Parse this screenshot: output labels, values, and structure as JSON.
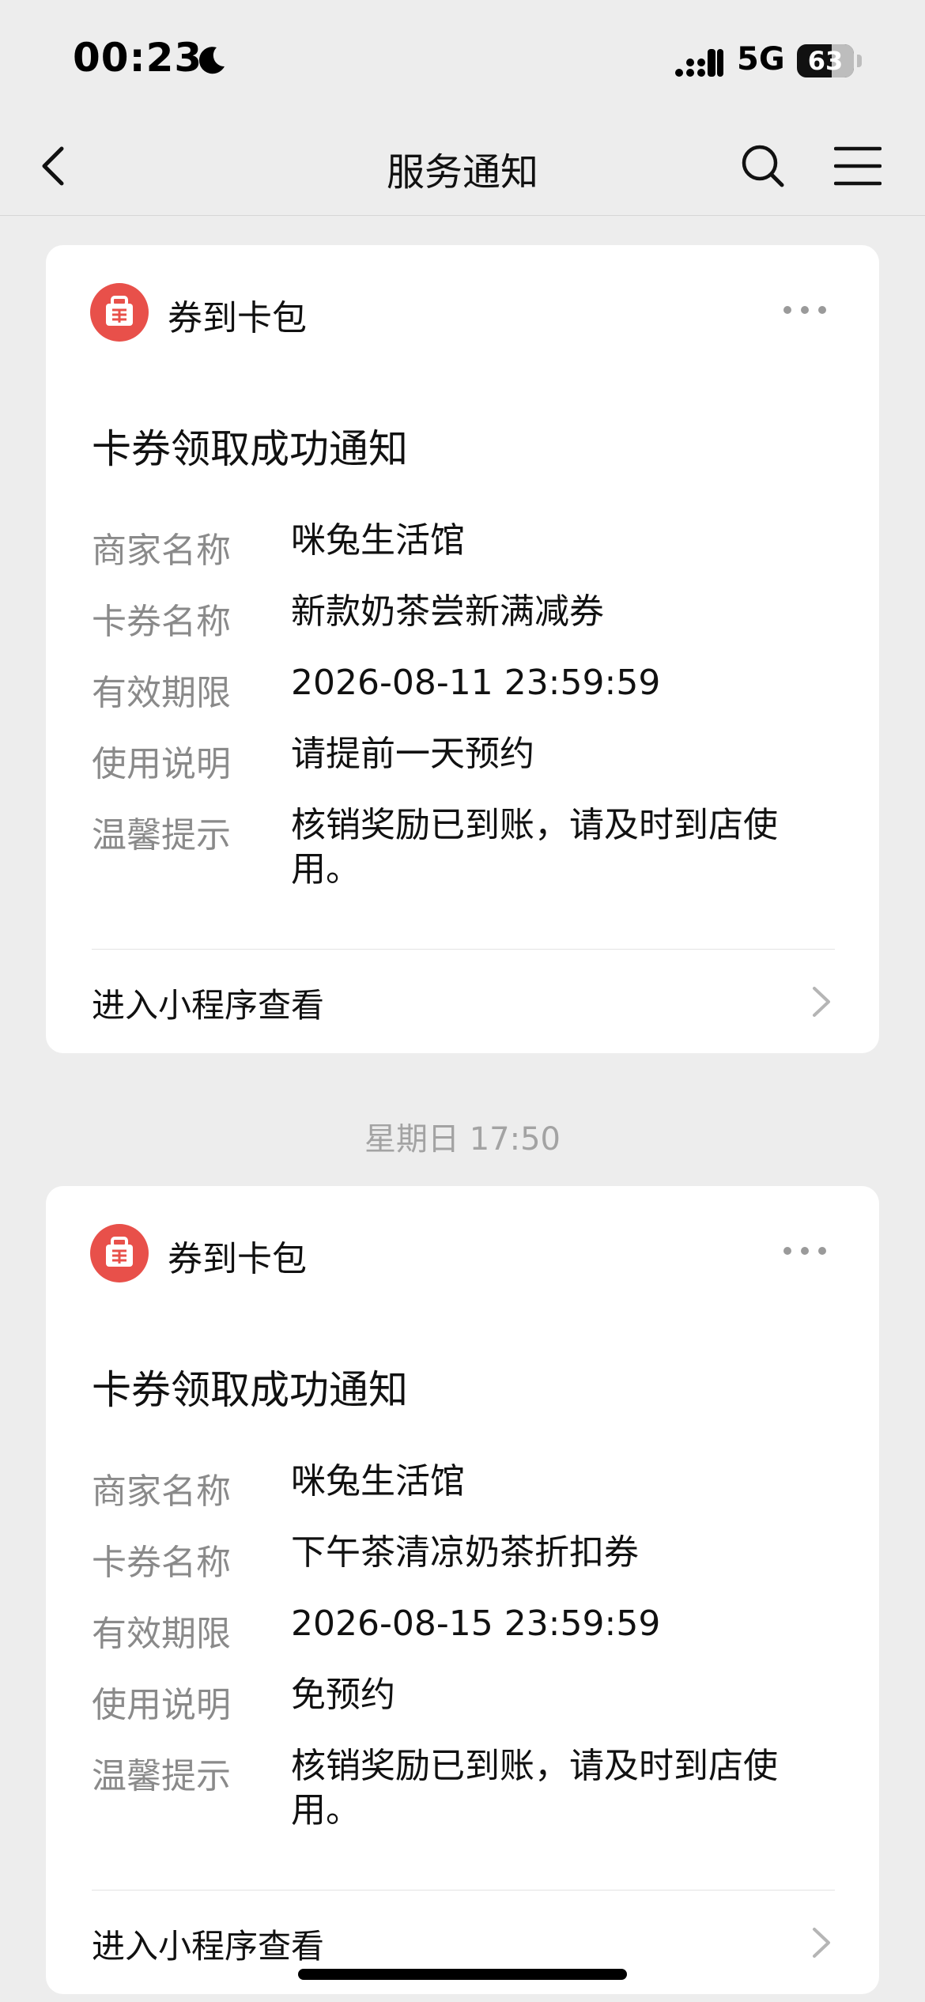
{
  "status_bar": {
    "time": "00:23",
    "network": "5G",
    "battery": "63"
  },
  "nav": {
    "title": "服务通知"
  },
  "timestamp": "星期日 17:50",
  "cards": [
    {
      "source": "券到卡包",
      "title": "卡券领取成功通知",
      "fields": [
        {
          "label": "商家名称",
          "value": "咪兔生活馆"
        },
        {
          "label": "卡券名称",
          "value": "新款奶茶尝新满减券"
        },
        {
          "label": "有效期限",
          "value": "2026-08-11 23:59:59"
        },
        {
          "label": "使用说明",
          "value": "请提前一天预约"
        },
        {
          "label": "温馨提示",
          "value": "核销奖励已到账，请及时到店使用。"
        }
      ],
      "footer": "进入小程序查看"
    },
    {
      "source": "券到卡包",
      "title": "卡券领取成功通知",
      "fields": [
        {
          "label": "商家名称",
          "value": "咪兔生活馆"
        },
        {
          "label": "卡券名称",
          "value": "下午茶清凉奶茶折扣券"
        },
        {
          "label": "有效期限",
          "value": "2026-08-15 23:59:59"
        },
        {
          "label": "使用说明",
          "value": "免预约"
        },
        {
          "label": "温馨提示",
          "value": "核销奖励已到账，请及时到店使用。"
        }
      ],
      "footer": "进入小程序查看"
    }
  ],
  "icons": {
    "back": "chevron-left-icon",
    "search": "search-icon",
    "menu": "menu-icon",
    "source": "gift-bag-icon",
    "more": "more-dots-icon",
    "footer": "chevron-right-icon",
    "status_moon": "moon-icon",
    "status_signal": "signal-icon"
  },
  "colors": {
    "background": "#ededed",
    "card": "#ffffff",
    "source_icon": "#e8504a",
    "label": "#8a8a8a",
    "timestamp": "#a3a3a3"
  }
}
